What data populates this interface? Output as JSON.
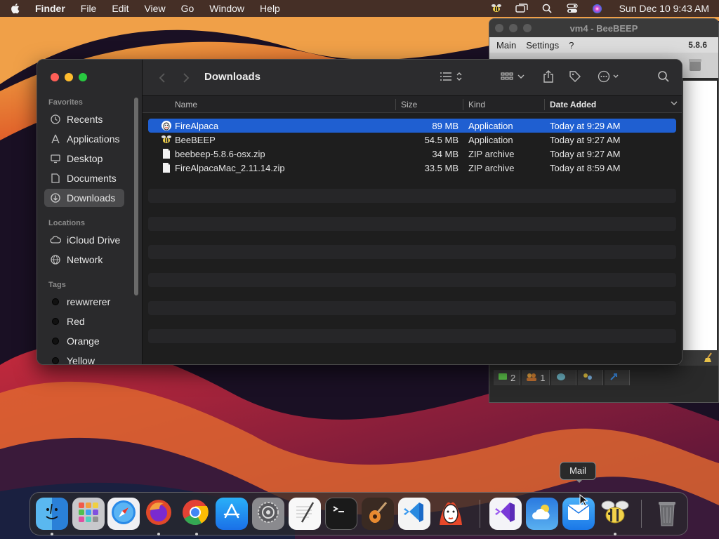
{
  "menubar": {
    "items": [
      "Finder",
      "File",
      "Edit",
      "View",
      "Go",
      "Window",
      "Help"
    ],
    "clock": "Sun Dec 10  9:43 AM",
    "icons": [
      "apple-icon",
      "beebeep-status-icon",
      "screen-mirroring-icon",
      "spotlight-icon",
      "control-center-icon",
      "siri-icon"
    ]
  },
  "beebeep": {
    "title": "vm4 - BeeBEEP",
    "menu": [
      "Main",
      "Settings",
      "?"
    ],
    "version": "5.8.6",
    "status": [
      {
        "icon": "chat-icon",
        "count": "2"
      },
      {
        "icon": "users-icon",
        "count": "1"
      },
      {
        "icon": "group-icon",
        "count": ""
      },
      {
        "icon": "contacts-icon",
        "count": ""
      },
      {
        "icon": "share-icon",
        "count": ""
      }
    ]
  },
  "finder": {
    "folder": "Downloads",
    "sidebar": {
      "favorites_title": "Favorites",
      "favorites": [
        {
          "label": "Recents",
          "icon": "clock-icon"
        },
        {
          "label": "Applications",
          "icon": "applications-icon"
        },
        {
          "label": "Desktop",
          "icon": "desktop-icon"
        },
        {
          "label": "Documents",
          "icon": "document-icon"
        },
        {
          "label": "Downloads",
          "icon": "download-icon"
        }
      ],
      "locations_title": "Locations",
      "locations": [
        {
          "label": "iCloud Drive",
          "icon": "cloud-icon"
        },
        {
          "label": "Network",
          "icon": "globe-icon"
        }
      ],
      "tags_title": "Tags",
      "tags": [
        {
          "label": "rewwrerer",
          "color": "#111111"
        },
        {
          "label": "Red",
          "color": "#111111"
        },
        {
          "label": "Orange",
          "color": "#111111"
        },
        {
          "label": "Yellow",
          "color": "#111111"
        }
      ]
    },
    "columns": {
      "name": "Name",
      "size": "Size",
      "kind": "Kind",
      "date": "Date Added"
    },
    "files": [
      {
        "name": "FireAlpaca",
        "size": "89 MB",
        "kind": "Application",
        "date": "Today at 9:29 AM",
        "icon": "firealpaca-icon"
      },
      {
        "name": "BeeBEEP",
        "size": "54.5 MB",
        "kind": "Application",
        "date": "Today at 9:27 AM",
        "icon": "beebeep-icon"
      },
      {
        "name": "beebeep-5.8.6-osx.zip",
        "size": "34 MB",
        "kind": "ZIP archive",
        "date": "Today at 9:27 AM",
        "icon": "zip-file-icon"
      },
      {
        "name": "FireAlpacaMac_2.11.14.zip",
        "size": "33.5 MB",
        "kind": "ZIP archive",
        "date": "Today at 8:59 AM",
        "icon": "zip-file-icon"
      }
    ]
  },
  "dock": {
    "tooltip": "Mail",
    "apps": [
      "finder",
      "launchpad",
      "safari",
      "firefox",
      "chrome",
      "app-store",
      "system-settings",
      "textedit",
      "terminal",
      "garageband",
      "vscode",
      "firealpaca",
      "visual-studio",
      "weather",
      "mail",
      "beebeep",
      "trash"
    ]
  }
}
